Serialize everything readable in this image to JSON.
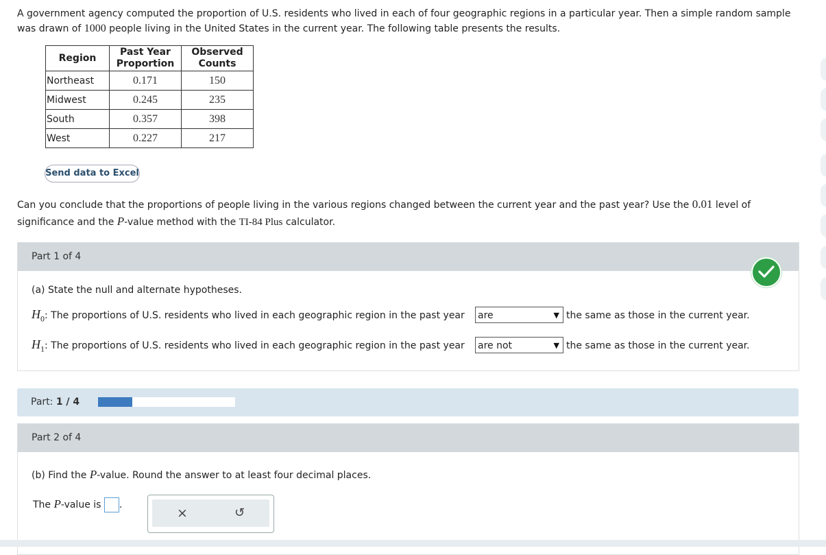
{
  "intro": {
    "text_a": "A government agency computed the proportion of U.S. residents who lived in each of four geographic regions in a particular year. Then a simple random sample was drawn of ",
    "sample_size": "1000",
    "text_b": " people living in the United States in the current year. The following table presents the results."
  },
  "table": {
    "headers": {
      "region": "Region",
      "prop_1": "Past Year",
      "prop_2": "Proportion",
      "obs_1": "Observed",
      "obs_2": "Counts"
    },
    "rows": [
      {
        "region": "Northeast",
        "proportion": "0.171",
        "count": "150"
      },
      {
        "region": "Midwest",
        "proportion": "0.245",
        "count": "235"
      },
      {
        "region": "South",
        "proportion": "0.357",
        "count": "398"
      },
      {
        "region": "West",
        "proportion": "0.227",
        "count": "217"
      }
    ]
  },
  "excel_button": "Send data to Excel",
  "question": {
    "a": "Can you conclude that the proportions of people living in the various regions changed between the current year and the past year? Use the ",
    "level": "0.01",
    "b": " level of significance and the ",
    "p": "P",
    "c": "-value method with the ",
    "calc": "TI-84 Plus",
    "d": " calculator."
  },
  "part1": {
    "header": "Part 1 of 4",
    "prompt": "(a) State the null and alternate hypotheses.",
    "h0_sym": "H",
    "h0_sub": "0",
    "h1_sym": "H",
    "h1_sub": "1",
    "hyp_text": ": The proportions of U.S. residents who lived in each geographic region in the past year",
    "h0_select": "are",
    "h1_select": "are not",
    "hyp_tail": "the same as those in the current year."
  },
  "progress": {
    "label": "Part: ",
    "value": "1 / 4",
    "fraction": 0.25
  },
  "part2": {
    "header": "Part 2 of 4",
    "prompt_a": "(b) Find the ",
    "p": "P",
    "prompt_b": "-value. Round the answer to at least four decimal places.",
    "answer_a": "The ",
    "answer_b": "-value is",
    "answer_end": "."
  },
  "icons": {
    "check": "check-icon",
    "clear": "x-icon",
    "undo": "undo-icon"
  },
  "colors": {
    "check": "#2e9e46",
    "progress_fill": "#3d7bbf",
    "header_bg": "#d2d8dc"
  }
}
